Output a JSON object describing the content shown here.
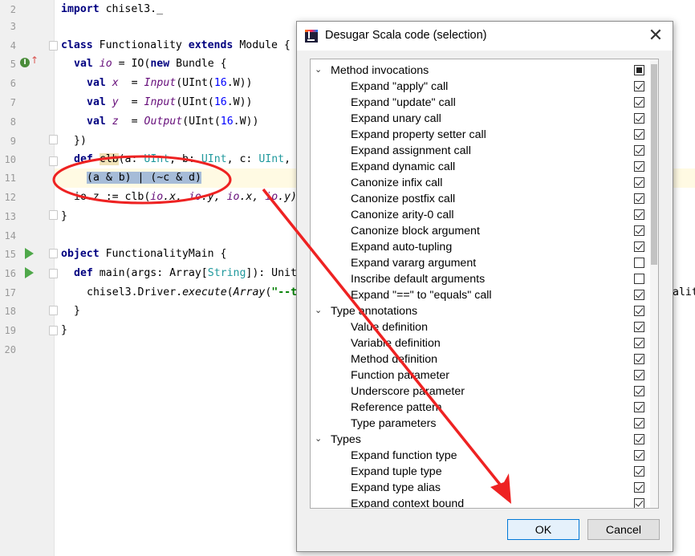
{
  "editor": {
    "line_numbers": [
      "2",
      "3",
      "4",
      "5",
      "6",
      "7",
      "8",
      "9",
      "10",
      "11",
      "12",
      "13",
      "14",
      "15",
      "16",
      "17",
      "18",
      "19",
      "20"
    ],
    "code": {
      "l2_kw": "import",
      "l2_rest": " chisel3._",
      "l4_kw1": "class",
      "l4_a": " Functionality ",
      "l4_kw2": "extends",
      "l4_b": " Module {",
      "l5_kw": "val",
      "l5_var": "io",
      "l5_a": " = IO(",
      "l5_kw2": "new",
      "l5_b": " Bundle {",
      "l6_kw": "val",
      "l6_var": "x",
      "l6_a": "  = ",
      "l6_fn": "Input",
      "l6_b": "(UInt(",
      "l6_num": "16",
      "l6_c": ".W))",
      "l7_kw": "val",
      "l7_var": "y",
      "l7_a": "  = ",
      "l7_fn": "Input",
      "l7_b": "(UInt(",
      "l7_num": "16",
      "l7_c": ".W))",
      "l8_kw": "val",
      "l8_var": "z",
      "l8_a": "  = ",
      "l8_fn": "Output",
      "l8_b": "(UInt(",
      "l8_num": "16",
      "l8_c": ".W))",
      "l9": "})",
      "l10_kw": "def",
      "l10_fn": "clb",
      "l10_a": "(a: ",
      "l10_t1": "UInt",
      "l10_b": ", b: ",
      "l10_t2": "UInt",
      "l10_c": ", c: ",
      "l10_t3": "UInt",
      "l10_d": ",",
      "l11_sel": "(a & b) | (~c & d)",
      "l12_a": "io.z := clb(",
      "l12_b": "io",
      "l12_c": ".x, ",
      "l12_d": "io",
      "l12_e": ".y, ",
      "l12_f": "io",
      "l12_g": ".x, ",
      "l12_h": "io",
      "l12_i": ".y)",
      "l13": "}",
      "l15_kw": "object",
      "l15_rest": " FunctionalityMain {",
      "l16_kw": "def",
      "l16_a": " main(args: Array[",
      "l16_t": "String",
      "l16_b": "]): Unit",
      "l17_a": "chisel3.Driver.",
      "l17_fn": "execute",
      "l17_b": "(",
      "l17_fn2": "Array",
      "l17_c": "(",
      "l17_str": "\"--t",
      "l17_tail": "alit",
      "l18": "}",
      "l19": "}"
    }
  },
  "dialog": {
    "title": "Desugar Scala code (selection)",
    "close_glyph": "✕",
    "ok_label": "OK",
    "cancel_label": "Cancel",
    "tree": [
      {
        "label": "Method invocations",
        "group": true,
        "state": "partial"
      },
      {
        "label": "Expand \"apply\" call",
        "state": "checked"
      },
      {
        "label": "Expand \"update\" call",
        "state": "checked"
      },
      {
        "label": "Expand unary call",
        "state": "checked"
      },
      {
        "label": "Expand property setter call",
        "state": "checked"
      },
      {
        "label": "Expand assignment call",
        "state": "checked"
      },
      {
        "label": "Expand dynamic call",
        "state": "checked"
      },
      {
        "label": "Canonize infix call",
        "state": "checked"
      },
      {
        "label": "Canonize postfix call",
        "state": "checked"
      },
      {
        "label": "Canonize arity-0 call",
        "state": "checked"
      },
      {
        "label": "Canonize block argument",
        "state": "checked"
      },
      {
        "label": "Expand auto-tupling",
        "state": "checked"
      },
      {
        "label": "Expand vararg argument",
        "state": "unchecked"
      },
      {
        "label": "Inscribe default arguments",
        "state": "unchecked"
      },
      {
        "label": "Expand \"==\" to \"equals\" call",
        "state": "checked"
      },
      {
        "label": "Type annotations",
        "group": true,
        "state": "checked"
      },
      {
        "label": "Value definition",
        "state": "checked"
      },
      {
        "label": "Variable definition",
        "state": "checked"
      },
      {
        "label": "Method definition",
        "state": "checked"
      },
      {
        "label": "Function parameter",
        "state": "checked"
      },
      {
        "label": "Underscore parameter",
        "state": "checked"
      },
      {
        "label": "Reference pattern",
        "state": "checked"
      },
      {
        "label": "Type parameters",
        "state": "checked"
      },
      {
        "label": "Types",
        "group": true,
        "state": "checked"
      },
      {
        "label": "Expand function type",
        "state": "checked"
      },
      {
        "label": "Expand tuple type",
        "state": "checked"
      },
      {
        "label": "Expand type alias",
        "state": "checked"
      },
      {
        "label": "Expand context bound",
        "state": "checked"
      }
    ]
  },
  "colors": {
    "annotation_red": "#ee2222",
    "keyword": "#000080",
    "selection": "#a6bcd8",
    "ok_border": "#0078d7"
  }
}
